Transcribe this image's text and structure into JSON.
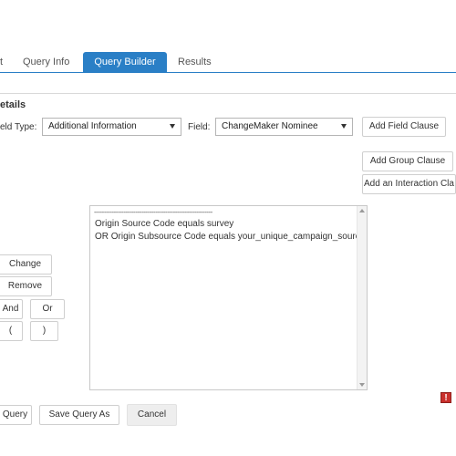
{
  "tabs": [
    {
      "label": "t"
    },
    {
      "label": "Query Info"
    },
    {
      "label": "Query Builder",
      "active": true
    },
    {
      "label": "Results"
    }
  ],
  "section_title": "etails",
  "field_type_label": "eld Type:",
  "field_type_value": "Additional Information",
  "field_label": "Field:",
  "field_value": "ChangeMaker Nominee",
  "buttons": {
    "add_field_clause": "Add Field Clause",
    "add_group_clause": "Add Group Clause",
    "add_interaction_clause": "Add an Interaction Cla",
    "change": "Change",
    "remove": "Remove",
    "and": "And",
    "or": "Or",
    "open_paren": "(",
    "close_paren": ")",
    "query": "Query",
    "save_query_as": "Save Query As",
    "cancel": "Cancel"
  },
  "query_text": {
    "separator": "------------------------------------------------------------",
    "line1": "Origin Source Code equals survey",
    "line2": "OR Origin Subsource Code equals your_unique_campaign_source"
  },
  "warning_glyph": "!",
  "colors": {
    "accent": "#2a7fc6",
    "warning": "#c9302c"
  }
}
